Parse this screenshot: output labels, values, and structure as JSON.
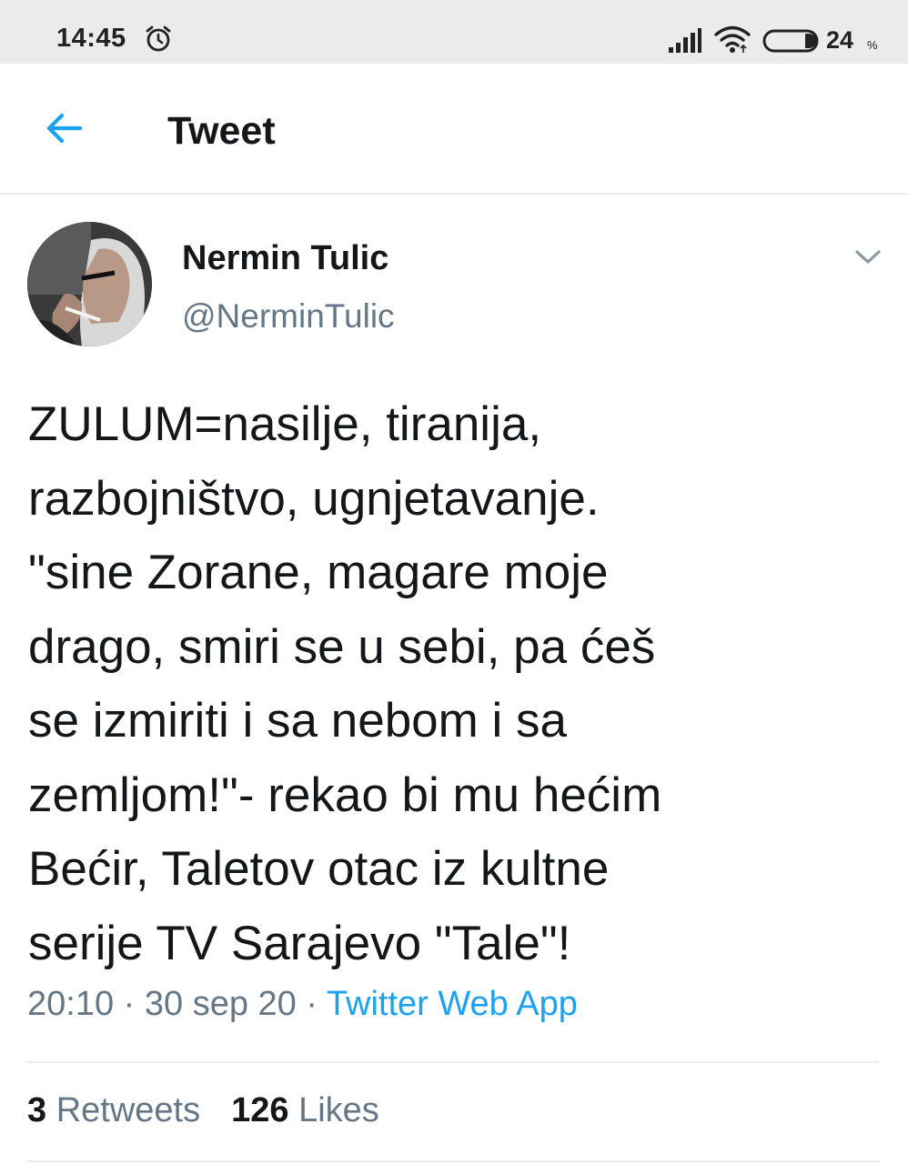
{
  "status_bar": {
    "time": "14:45",
    "battery": "24",
    "battery_unit": "%",
    "icons": [
      "alarm-icon",
      "signal-icon",
      "wifi-icon",
      "battery-icon"
    ]
  },
  "header": {
    "title": "Tweet",
    "back_icon": "arrow-left-icon"
  },
  "tweet": {
    "author_name": "Nermin Tulic",
    "author_handle": "@NerminTulic",
    "text_lines": [
      "ZULUM=nasilje, tiranija,",
      "razbojništvo, ugnjetavanje.",
      "\"sine Zorane, magare moje",
      "drago, smiri se u sebi, pa ćeš",
      "se izmiriti i sa nebom i sa",
      "zemljom!\"- rekao bi mu hećim",
      "Bećir, Taletov otac iz kultne",
      "serije TV Sarajevo \"Tale\"!"
    ],
    "time": "20:10",
    "date": "30 sep 20",
    "separator": "·",
    "source": "Twitter Web App",
    "retweets_count": "3",
    "retweets_label": "Retweets",
    "likes_count": "126",
    "likes_label": "Likes"
  },
  "colors": {
    "accent": "#1da1f2",
    "secondary_text": "#657786",
    "primary_text": "#14171a",
    "divider": "#e6ecf0"
  }
}
